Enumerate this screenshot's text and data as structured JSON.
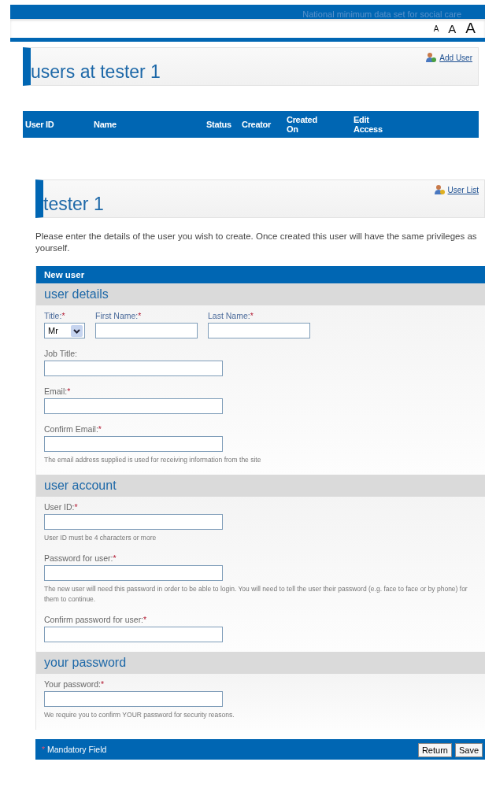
{
  "banner": {
    "title": "National minimum data set for social care"
  },
  "text_size": [
    {
      "label": "A",
      "kind": "small"
    },
    {
      "label": "A",
      "kind": "medium"
    },
    {
      "label": "A",
      "kind": "large"
    }
  ],
  "users_panel": {
    "title": "users at tester 1",
    "link": "Add User"
  },
  "table": {
    "columns": [
      "User ID",
      "Name",
      "Status",
      "Creator",
      "Created On",
      "Edit Access"
    ]
  },
  "user_panel": {
    "title": "tester 1",
    "link": "User List"
  },
  "intro": "Please enter the details of the user you wish to create. Once created this user will have the same privileges as yourself.",
  "form": {
    "title": "New user",
    "sections": [
      {
        "heading": "user details",
        "name_row": [
          {
            "kind": "select",
            "label": "Title:",
            "required_mark": "*",
            "value": "Mr"
          },
          {
            "kind": "text",
            "label": "First Name:",
            "required_mark": "*"
          },
          {
            "kind": "text",
            "label": "Last Name:",
            "required_mark": "*"
          }
        ],
        "fields": [
          {
            "label": "Job Title:"
          },
          {
            "label": "Email:",
            "required_mark": "*"
          },
          {
            "label": "Confirm Email:",
            "required_mark": "*",
            "hint": "The email address supplied is used for receiving information from the site"
          }
        ]
      },
      {
        "heading": "user account",
        "fields": [
          {
            "label": "User ID:",
            "required_mark": "*",
            "hint": "User ID must be 4 characters or more"
          },
          {
            "label": "Password for user:",
            "required_mark": "*",
            "hint": "The new user will need this password in order to be able to login. You will need to tell the user their password (e.g. face to face or by phone) for them to continue."
          },
          {
            "label": "Confirm password for user:",
            "required_mark": "*"
          }
        ]
      },
      {
        "heading": "your password",
        "fields": [
          {
            "label": "Your password:",
            "required_mark": "*",
            "hint": "We require you to confirm YOUR password for security reasons."
          }
        ]
      }
    ]
  },
  "footer": {
    "mark": "*",
    "text": "Mandatory Field",
    "buttons": [
      "Return",
      "Save"
    ]
  }
}
